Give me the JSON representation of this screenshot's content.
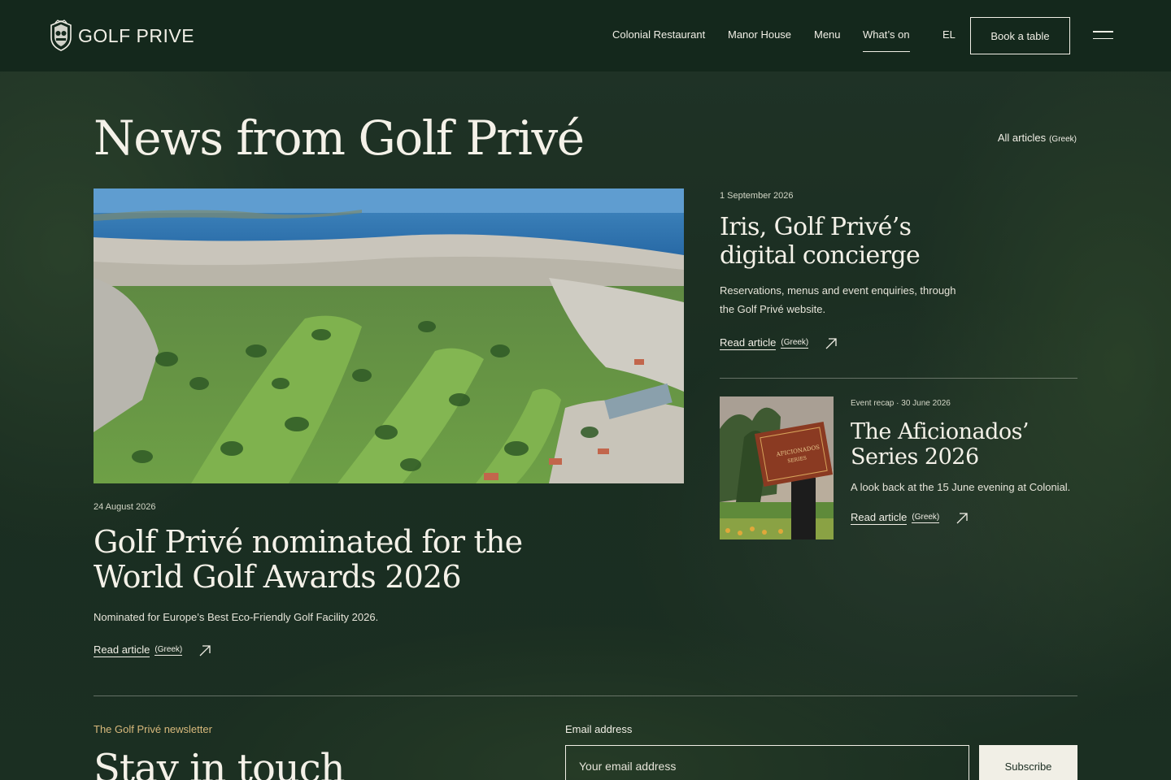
{
  "header": {
    "logo_text": "GOLF PRIVE",
    "nav": [
      {
        "label": "Colonial Restaurant"
      },
      {
        "label": "Manor House"
      },
      {
        "label": "Menu"
      },
      {
        "label": "What’s on",
        "active": true
      }
    ],
    "lang": "EL",
    "book_label": "Book a table"
  },
  "main": {
    "title": "News from Golf Privé",
    "all_articles": "All articles",
    "all_articles_tag": "(Greek)",
    "feature": {
      "date": "24 August 2026",
      "title_line1": "Golf Privé nominated for the",
      "title_line2": "World Golf Awards 2026",
      "summary": "Nominated for Europe’s Best Eco-Friendly Golf Facility 2026.",
      "link": "Read article",
      "link_tag": "(Greek)"
    },
    "side_article": {
      "date": "1 September 2026",
      "title_line1": "Iris, Golf Privé’s",
      "title_line2": "digital concierge",
      "summary_line1": "Reservations, menus and event enquiries, through",
      "summary_line2": "the Golf Privé website.",
      "link": "Read article",
      "link_tag": "(Greek)"
    },
    "recap_article": {
      "date": "Event recap · 30 June 2026",
      "title_line1": "The Aficionados’",
      "title_line2": "Series 2026",
      "summary": "A look back at the 15 June evening at Colonial.",
      "link": "Read article",
      "link_tag": "(Greek)"
    }
  },
  "newsletter": {
    "label": "The Golf Privé newsletter",
    "title": "Stay in touch",
    "email_label": "Email address",
    "email_placeholder": "Your email address",
    "subscribe_label": "Subscribe"
  },
  "colors": {
    "header_bg": "#14281c",
    "page_bg": "#1b2d22",
    "accent": "#d8b97c",
    "text": "#f1efe6"
  },
  "icons": [
    "crest-logo-icon",
    "menu-icon",
    "arrow-up-right-icon"
  ]
}
